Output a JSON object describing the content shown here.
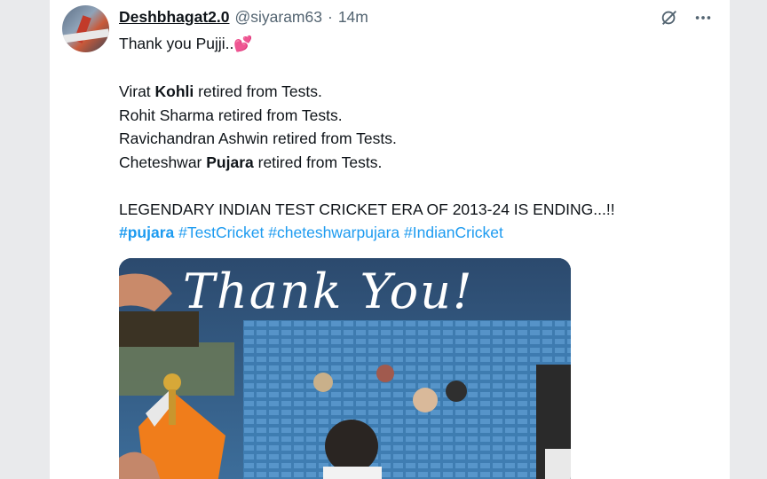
{
  "tweet": {
    "display_name": "Deshbhagat2.0",
    "handle": "@siyaram63",
    "separator": "·",
    "time": "14m",
    "lines": {
      "line1": "Thank you Pujji..",
      "line1_emoji": "💕",
      "l2_a": "Virat ",
      "l2_b": "Kohli",
      "l2_c": " retired from Tests.",
      "l3": "Rohit Sharma retired from Tests.",
      "l4": "Ravichandran Ashwin retired from Tests.",
      "l5_a": "Cheteshwar ",
      "l5_b": "Pujara",
      "l5_c": " retired from Tests.",
      "l6": "LEGENDARY INDIAN TEST CRICKET ERA OF 2013-24 IS ENDING...!!"
    },
    "hashtags": [
      "#pujara",
      "#TestCricket",
      "#cheteshwarpujara",
      "#IndianCricket"
    ],
    "media_caption": "Thank You!"
  },
  "icons": {
    "grok": "grok-icon",
    "more": "more-options-icon"
  },
  "colors": {
    "link": "#1d9bf0",
    "text": "#0f1419",
    "muted": "#536471"
  }
}
